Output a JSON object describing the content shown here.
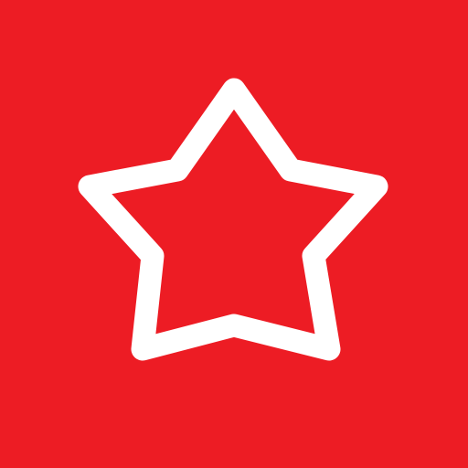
{
  "icon": {
    "name": "star-outline-icon",
    "background_color": "#ED1C24",
    "stroke_color": "#FFFFFF"
  }
}
